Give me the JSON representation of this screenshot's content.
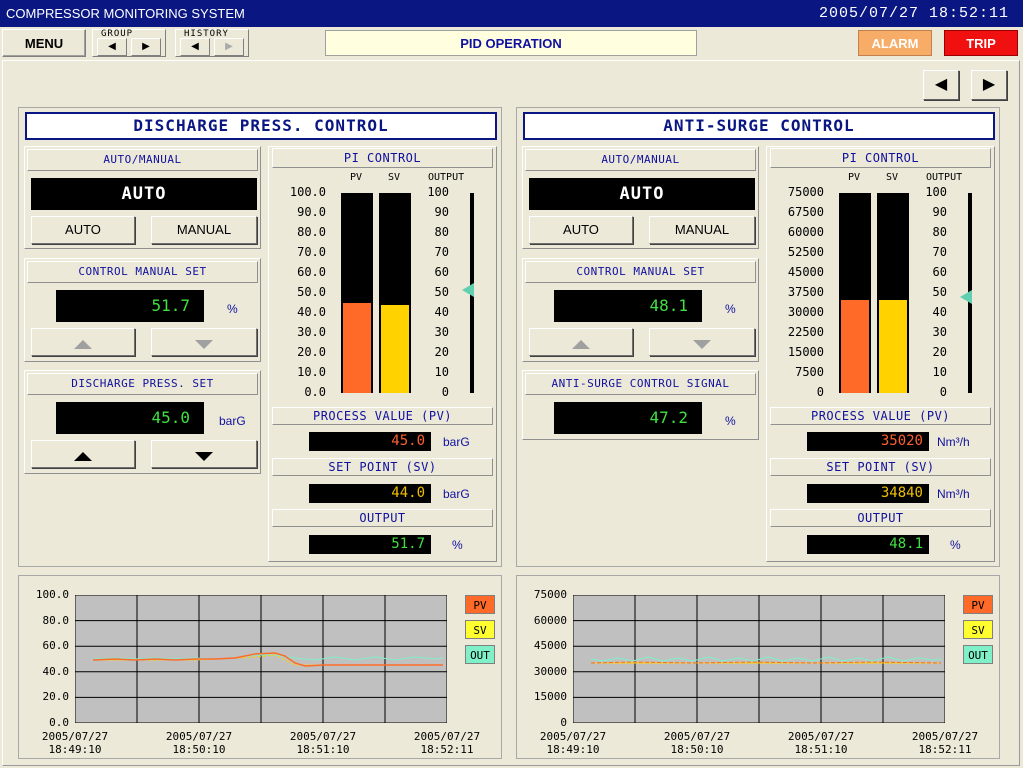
{
  "app": {
    "title": "COMPRESSOR MONITORING SYSTEM",
    "datetime": "2005/07/27  18:52:11"
  },
  "toolbar": {
    "menu": "MENU",
    "group": "GROUP",
    "history": "HISTORY",
    "banner": "PID OPERATION",
    "alarm": "ALARM",
    "trip": "TRIP"
  },
  "icons": {
    "prev": "triangle-left-icon",
    "next": "triangle-right-icon",
    "up": "triangle-up-icon",
    "down": "triangle-down-icon"
  },
  "colors": {
    "pv": "#ff6a28",
    "sv": "#ffd200",
    "out": "#80f0c8",
    "title_bar": "#0a1682",
    "value_green": "#40e040"
  },
  "discharge": {
    "title": "DISCHARGE PRESS. CONTROL",
    "auto_manual_label": "AUTO/MANUAL",
    "mode": "AUTO",
    "auto_btn": "AUTO",
    "manual_btn": "MANUAL",
    "cms_label": "CONTROL MANUAL SET",
    "cms_value": "51.7",
    "cms_unit": "%",
    "set_label": "DISCHARGE PRESS. SET",
    "set_value": "45.0",
    "set_unit": "barG",
    "pi_label": "PI CONTROL",
    "pv_head": "PV",
    "sv_head": "SV",
    "out_head": "OUTPUT",
    "scale": [
      "100.0",
      "90.0",
      "80.0",
      "70.0",
      "60.0",
      "50.0",
      "40.0",
      "30.0",
      "20.0",
      "10.0",
      "0.0"
    ],
    "out_scale": [
      "100",
      "90",
      "80",
      "70",
      "60",
      "50",
      "40",
      "30",
      "20",
      "10",
      "0"
    ],
    "pv_pct": 45,
    "sv_pct": 44,
    "out_pct": 51.7,
    "pv_label": "PROCESS VALUE (PV)",
    "pv_value": "45.0",
    "pv_unit": "barG",
    "sv_label": "SET POINT (SV)",
    "sv_value": "44.0",
    "sv_unit": "barG",
    "out_label": "OUTPUT",
    "out_value": "51.7",
    "out_unit": "%"
  },
  "antisurge": {
    "title": "ANTI-SURGE CONTROL",
    "auto_manual_label": "AUTO/MANUAL",
    "mode": "AUTO",
    "auto_btn": "AUTO",
    "manual_btn": "MANUAL",
    "cms_label": "CONTROL MANUAL SET",
    "cms_value": "48.1",
    "cms_unit": "%",
    "sig_label": "ANTI-SURGE CONTROL SIGNAL",
    "sig_value": "47.2",
    "sig_unit": "%",
    "pi_label": "PI CONTROL",
    "pv_head": "PV",
    "sv_head": "SV",
    "out_head": "OUTPUT",
    "scale": [
      "75000",
      "67500",
      "60000",
      "52500",
      "45000",
      "37500",
      "30000",
      "22500",
      "15000",
      "7500",
      "0"
    ],
    "out_scale": [
      "100",
      "90",
      "80",
      "70",
      "60",
      "50",
      "40",
      "30",
      "20",
      "10",
      "0"
    ],
    "pv_pct": 46.7,
    "sv_pct": 46.5,
    "out_pct": 48.1,
    "pv_label": "PROCESS VALUE (PV)",
    "pv_value": "35020",
    "pv_unit": "Nm³/h",
    "sv_label": "SET POINT (SV)",
    "sv_value": "34840",
    "sv_unit": "Nm³/h",
    "out_label": "OUTPUT",
    "out_value": "48.1",
    "out_unit": "%"
  },
  "trend_left": {
    "yticks": [
      "100.0",
      "80.0",
      "60.0",
      "40.0",
      "20.0",
      "0.0"
    ],
    "xticks": [
      [
        "2005/07/27",
        "18:49:10"
      ],
      [
        "2005/07/27",
        "18:50:10"
      ],
      [
        "2005/07/27",
        "18:51:10"
      ],
      [
        "2005/07/27",
        "18:52:11"
      ]
    ],
    "legend": [
      "PV",
      "SV",
      "OUT"
    ]
  },
  "trend_right": {
    "yticks": [
      "75000",
      "60000",
      "45000",
      "30000",
      "15000",
      "0"
    ],
    "xticks": [
      [
        "2005/07/27",
        "18:49:10"
      ],
      [
        "2005/07/27",
        "18:50:10"
      ],
      [
        "2005/07/27",
        "18:51:10"
      ],
      [
        "2005/07/27",
        "18:52:11"
      ]
    ],
    "legend": [
      "PV",
      "SV",
      "OUT"
    ]
  }
}
